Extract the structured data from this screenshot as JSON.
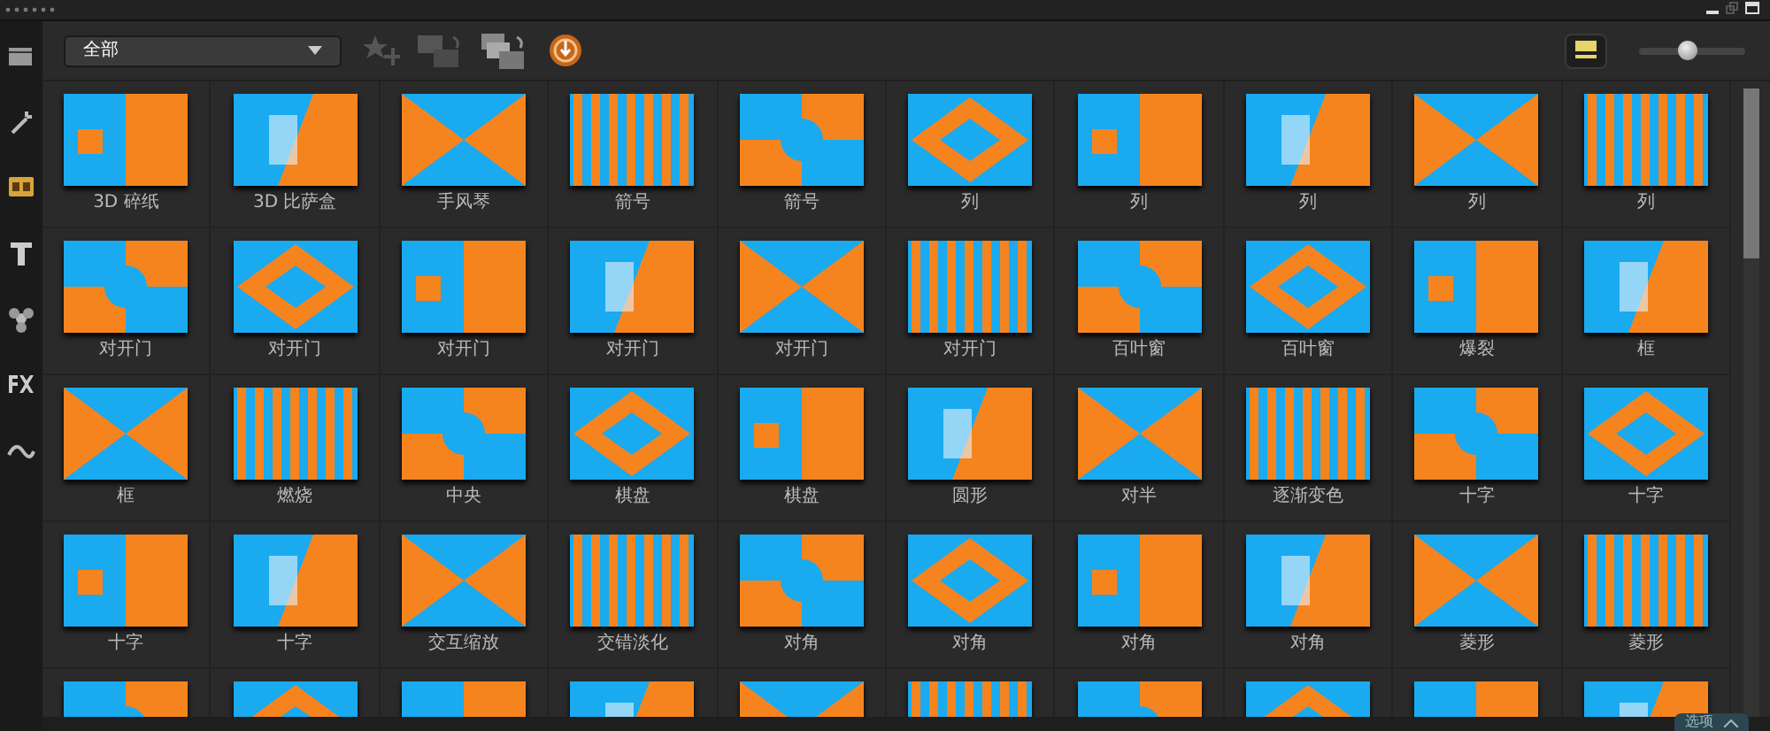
{
  "toolbar": {
    "category": "全部",
    "slider": {
      "level": 0.45
    }
  },
  "thumbnails": [
    {
      "kind": "picture",
      "label": "3D 碎纸"
    },
    {
      "kind": "picture",
      "label": "3D 比萨盒"
    },
    {
      "kind": "picture",
      "label": "手风琴"
    },
    {
      "kind": "picture",
      "label": "箭号"
    },
    {
      "kind": "picture",
      "label": "箭号"
    },
    {
      "kind": "picture",
      "label": "列"
    },
    {
      "kind": "picture",
      "label": "列"
    },
    {
      "kind": "picture",
      "label": "列"
    },
    {
      "kind": "picture",
      "label": "列"
    },
    {
      "kind": "picture",
      "label": "列"
    },
    {
      "kind": "picture",
      "label": "对开门"
    },
    {
      "kind": "picture",
      "label": "对开门"
    },
    {
      "kind": "picture",
      "label": "对开门"
    },
    {
      "kind": "picture",
      "label": "对开门"
    },
    {
      "kind": "picture",
      "label": "对开门"
    },
    {
      "kind": "picture",
      "label": "对开门"
    },
    {
      "kind": "picture",
      "label": "百叶窗"
    },
    {
      "kind": "picture",
      "label": "百叶窗"
    },
    {
      "kind": "picture",
      "label": "爆裂"
    },
    {
      "kind": "picture",
      "label": "框"
    },
    {
      "kind": "picture",
      "label": "框"
    },
    {
      "kind": "picture",
      "label": "燃烧"
    },
    {
      "kind": "picture",
      "label": "中央"
    },
    {
      "kind": "picture",
      "label": "棋盘"
    },
    {
      "kind": "picture",
      "label": "棋盘"
    },
    {
      "kind": "picture",
      "label": "圆形"
    },
    {
      "kind": "picture",
      "label": "对半"
    },
    {
      "kind": "picture",
      "label": "逐渐变色"
    },
    {
      "kind": "picture",
      "label": "十字"
    },
    {
      "kind": "picture",
      "label": "十字"
    },
    {
      "kind": "picture",
      "label": "十字"
    },
    {
      "kind": "picture",
      "label": "十字"
    },
    {
      "kind": "picture",
      "label": "交互缩放"
    },
    {
      "kind": "picture",
      "label": "交错淡化"
    },
    {
      "kind": "picture",
      "label": "对角"
    },
    {
      "kind": "picture",
      "label": "对角"
    },
    {
      "kind": "picture",
      "label": "对角"
    },
    {
      "kind": "picture",
      "label": "对角"
    },
    {
      "kind": "picture",
      "label": "菱形"
    },
    {
      "kind": "picture",
      "label": "菱形"
    },
    {
      "kind": "picture"
    },
    {
      "kind": "picture"
    },
    {
      "kind": "picture"
    },
    {
      "kind": "picture"
    },
    {
      "kind": "picture"
    },
    {
      "kind": "picture"
    },
    {
      "kind": "picture"
    },
    {
      "kind": "picture"
    },
    {
      "kind": "picture"
    },
    {
      "kind": "picture"
    }
  ],
  "options_button": {
    "label": "选项"
  }
}
